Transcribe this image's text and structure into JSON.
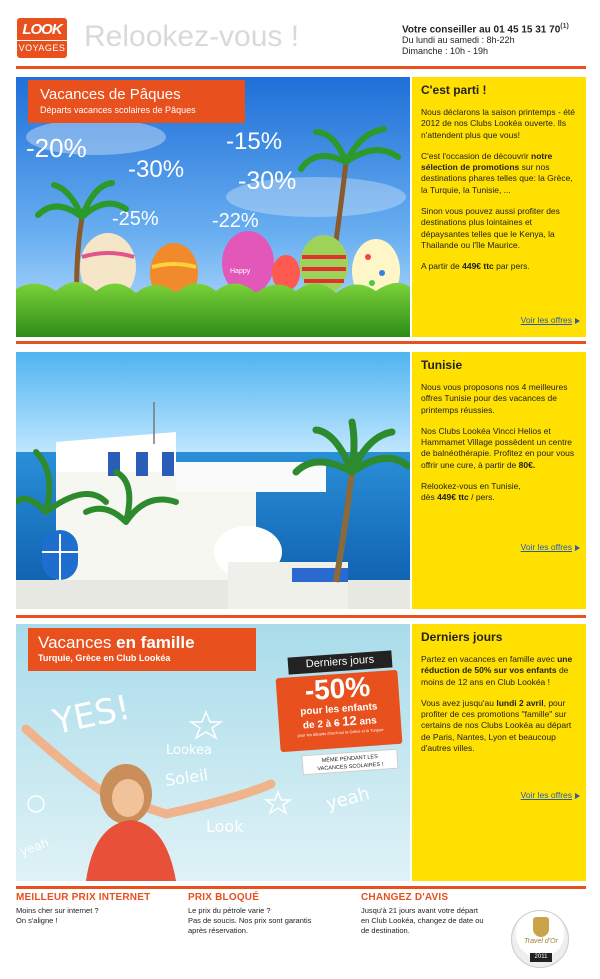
{
  "header": {
    "logo_top": "LOOK",
    "logo_bottom": "VOYAGES",
    "tagline": "Relookez-vous !",
    "contact_label": "Votre conseiller au",
    "phone": "01 45 15 31 70",
    "phone_note": "(1)",
    "hours_weekdays": "Du lundi au samedi : 8h-22h",
    "hours_sunday": "Dimanche : 10h - 19h"
  },
  "colors": {
    "accent": "#e8501e",
    "panel": "#ffe000",
    "link": "#2a5db0"
  },
  "section1": {
    "banner_title": "Vacances de Pâques",
    "banner_subtitle": "Départs vacances scolaires de Pâques",
    "discounts": [
      "-20%",
      "-30%",
      "-15%",
      "-30%",
      "-25%",
      "-22%"
    ],
    "egg_text": "Happy",
    "heading": "C'est parti !",
    "p1": "Nous déclarons la saison printemps - été 2012 de nos Clubs Lookéa ouverte. Ils n'attendent plus que vous!",
    "p2_pre": "C'est l'occasion de découvrir ",
    "p2_bold": "notre sélection de promotions",
    "p2_post": " sur nos destinations phares telles que: la Grèce, la Turquie, la Tunisie, ...",
    "p3": "Sinon vous pouvez aussi profiter des destinations plus lointaines et dépaysantes telles que le Kenya, la Thailande ou l'île Maurice.",
    "p4_pre": "A partir de ",
    "p4_bold": "449€ ttc",
    "p4_post": " par pers.",
    "link": "Voir les offres"
  },
  "section2": {
    "heading": "Tunisie",
    "p1": "Nous vous proposons nos 4 meilleures offres Tunisie pour des vacances de printemps réussies.",
    "p2_pre": "Nos Clubs Lookéa Vincci Helios et Hammamet Village possèdent un centre de balnéothérapie. Profitez en pour vous offrir une cure, à partir de ",
    "p2_bold": "80€.",
    "p3_line1": "Relookez-vous en Tunisie,",
    "p3_pre": "dès ",
    "p3_bold": "449€ ttc",
    "p3_post": " / pers.",
    "link": "Voir les offres"
  },
  "section3": {
    "banner_title_pre": "Vacances ",
    "banner_title_bold": "en famille",
    "banner_subtitle": "Turquie, Grèce en Club Lookéa",
    "promo_tag": "Derniers jours",
    "promo_value": "-50%",
    "promo_line1": "pour les enfants",
    "promo_line2_pre": "de 2 à ",
    "promo_line2_strike": "6",
    "promo_line2_num": "12",
    "promo_line2_post": " ans",
    "promo_fine": "pour les départs d'avril sur la Grèce et la Turquie",
    "promo_note1": "MÊME PENDANT LES",
    "promo_note2": "VACANCES SCOLAIRES !",
    "doodles": [
      "YES!",
      "Lookea",
      "Soleil",
      "yeah",
      "Look",
      "yeah"
    ],
    "heading": "Derniers jours",
    "p1_pre": "Partez en vacances en famille avec ",
    "p1_bold": "une réduction de 50% sur vos enfants",
    "p1_post": " de moins de 12 ans en Club Lookéa !",
    "p2_pre": "Vous avez jusqu'au ",
    "p2_bold": "lundi 2 avril",
    "p2_post": ", pour profiter de ces promotions \"famille\" sur certains de nos Clubs Lookéa au départ de Paris, Nantes, Lyon et beaucoup d'autres villes.",
    "link": "Voir les offres"
  },
  "footer": {
    "col1_title": "MEILLEUR PRIX INTERNET",
    "col1_l1": "Moins cher sur internet ?",
    "col1_l2": "On s'aligne !",
    "col2_title": "PRIX BLOQUÉ",
    "col2_l1": "Le prix du pétrole varie ?",
    "col2_l2": "Pas de soucis. Nos prix sont garantis",
    "col2_l3": "après réservation.",
    "col3_title": "CHANGEZ D'AVIS",
    "col3_l1": "Jusqu'à 21 jours avant votre départ",
    "col3_l2": "en Club Lookéa, changez de date ou",
    "col3_l3": "de destination.",
    "badge_text": "Travel d'Or",
    "badge_year": "2011"
  }
}
